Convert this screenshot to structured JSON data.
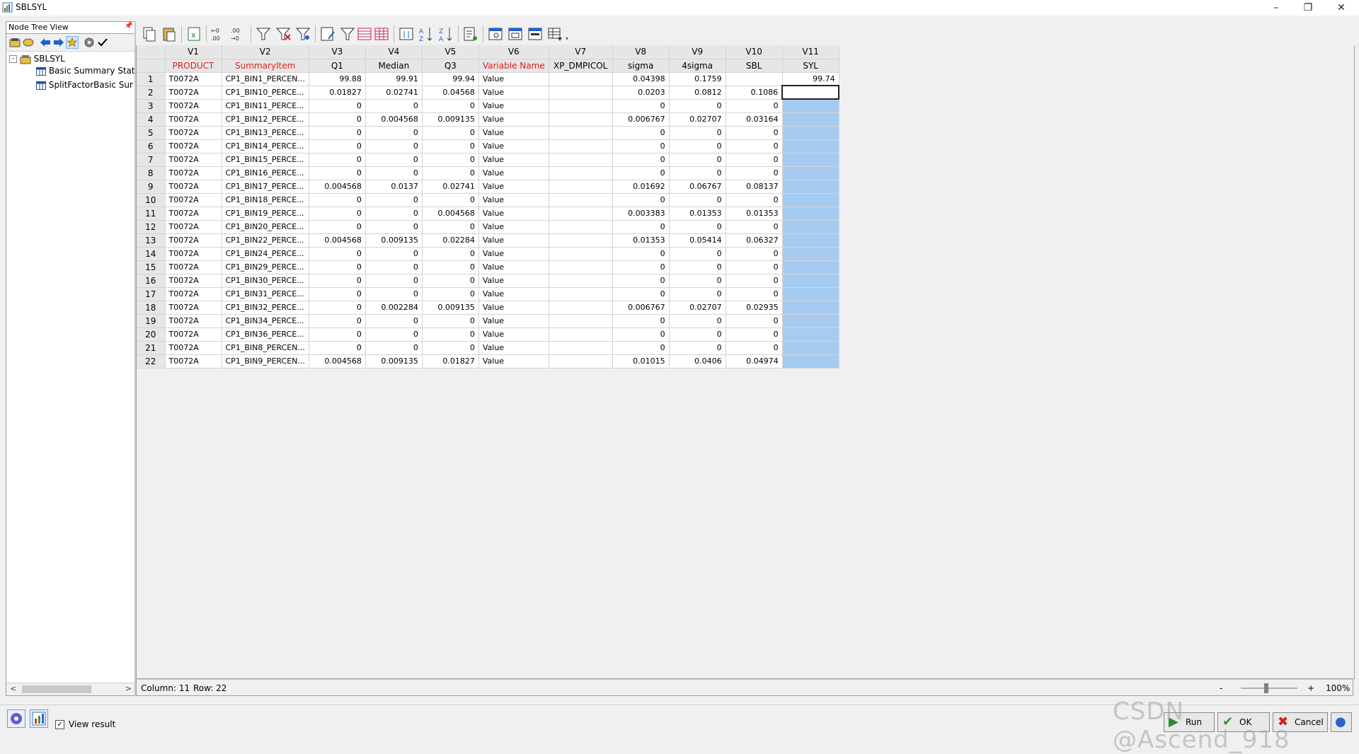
{
  "window": {
    "title": "SBLSYL"
  },
  "node_tree": {
    "header": "Node Tree View",
    "root": "SBLSYL",
    "children": [
      "Basic Summary Stat",
      "SplitFactorBasic Sur"
    ]
  },
  "grid": {
    "col_headers": [
      "V1",
      "V2",
      "V3",
      "V4",
      "V5",
      "V6",
      "V7",
      "V8",
      "V9",
      "V10",
      "V11"
    ],
    "var_names": [
      "PRODUCT",
      "SummaryItem",
      "Q1",
      "Median",
      "Q3",
      "Variable Name",
      "XP_DMPICOL",
      "sigma",
      "4sigma",
      "SBL",
      "SYL"
    ],
    "rows": [
      [
        "1",
        "T0072A",
        "CP1_BIN1_PERCEN...",
        "99.88",
        "99.91",
        "99.94",
        "Value",
        "",
        "0.04398",
        "0.1759",
        "",
        "99.74"
      ],
      [
        "2",
        "T0072A",
        "CP1_BIN10_PERCE...",
        "0.01827",
        "0.02741",
        "0.04568",
        "Value",
        "",
        "0.0203",
        "0.0812",
        "0.1086",
        ""
      ],
      [
        "3",
        "T0072A",
        "CP1_BIN11_PERCE...",
        "0",
        "0",
        "0",
        "Value",
        "",
        "0",
        "0",
        "0",
        ""
      ],
      [
        "4",
        "T0072A",
        "CP1_BIN12_PERCE...",
        "0",
        "0.004568",
        "0.009135",
        "Value",
        "",
        "0.006767",
        "0.02707",
        "0.03164",
        ""
      ],
      [
        "5",
        "T0072A",
        "CP1_BIN13_PERCE...",
        "0",
        "0",
        "0",
        "Value",
        "",
        "0",
        "0",
        "0",
        ""
      ],
      [
        "6",
        "T0072A",
        "CP1_BIN14_PERCE...",
        "0",
        "0",
        "0",
        "Value",
        "",
        "0",
        "0",
        "0",
        ""
      ],
      [
        "7",
        "T0072A",
        "CP1_BIN15_PERCE...",
        "0",
        "0",
        "0",
        "Value",
        "",
        "0",
        "0",
        "0",
        ""
      ],
      [
        "8",
        "T0072A",
        "CP1_BIN16_PERCE...",
        "0",
        "0",
        "0",
        "Value",
        "",
        "0",
        "0",
        "0",
        ""
      ],
      [
        "9",
        "T0072A",
        "CP1_BIN17_PERCE...",
        "0.004568",
        "0.0137",
        "0.02741",
        "Value",
        "",
        "0.01692",
        "0.06767",
        "0.08137",
        ""
      ],
      [
        "10",
        "T0072A",
        "CP1_BIN18_PERCE...",
        "0",
        "0",
        "0",
        "Value",
        "",
        "0",
        "0",
        "0",
        ""
      ],
      [
        "11",
        "T0072A",
        "CP1_BIN19_PERCE...",
        "0",
        "0",
        "0.004568",
        "Value",
        "",
        "0.003383",
        "0.01353",
        "0.01353",
        ""
      ],
      [
        "12",
        "T0072A",
        "CP1_BIN20_PERCE...",
        "0",
        "0",
        "0",
        "Value",
        "",
        "0",
        "0",
        "0",
        ""
      ],
      [
        "13",
        "T0072A",
        "CP1_BIN22_PERCE...",
        "0.004568",
        "0.009135",
        "0.02284",
        "Value",
        "",
        "0.01353",
        "0.05414",
        "0.06327",
        ""
      ],
      [
        "14",
        "T0072A",
        "CP1_BIN24_PERCE...",
        "0",
        "0",
        "0",
        "Value",
        "",
        "0",
        "0",
        "0",
        ""
      ],
      [
        "15",
        "T0072A",
        "CP1_BIN29_PERCE...",
        "0",
        "0",
        "0",
        "Value",
        "",
        "0",
        "0",
        "0",
        ""
      ],
      [
        "16",
        "T0072A",
        "CP1_BIN30_PERCE...",
        "0",
        "0",
        "0",
        "Value",
        "",
        "0",
        "0",
        "0",
        ""
      ],
      [
        "17",
        "T0072A",
        "CP1_BIN31_PERCE...",
        "0",
        "0",
        "0",
        "Value",
        "",
        "0",
        "0",
        "0",
        ""
      ],
      [
        "18",
        "T0072A",
        "CP1_BIN32_PERCE...",
        "0",
        "0.002284",
        "0.009135",
        "Value",
        "",
        "0.006767",
        "0.02707",
        "0.02935",
        ""
      ],
      [
        "19",
        "T0072A",
        "CP1_BIN34_PERCE...",
        "0",
        "0",
        "0",
        "Value",
        "",
        "0",
        "0",
        "0",
        ""
      ],
      [
        "20",
        "T0072A",
        "CP1_BIN36_PERCE...",
        "0",
        "0",
        "0",
        "Value",
        "",
        "0",
        "0",
        "0",
        ""
      ],
      [
        "21",
        "T0072A",
        "CP1_BIN8_PERCEN...",
        "0",
        "0",
        "0",
        "Value",
        "",
        "0",
        "0",
        "0",
        ""
      ],
      [
        "22",
        "T0072A",
        "CP1_BIN9_PERCEN...",
        "0.004568",
        "0.009135",
        "0.01827",
        "Value",
        "",
        "0.01015",
        "0.0406",
        "0.04974",
        ""
      ]
    ]
  },
  "status": {
    "column": "Column: 11",
    "row": "Row: 22",
    "zoom_minus": "-",
    "zoom_plus": "+",
    "zoom_level": "100%"
  },
  "bottom": {
    "view_result_label": "View result",
    "run_label": "Run",
    "ok_label": "OK",
    "cancel_label": "Cancel"
  },
  "watermark": "CSDN @Ascend_918",
  "colors": {
    "selection": "#a6cbf0",
    "red_header": "#e02020"
  }
}
